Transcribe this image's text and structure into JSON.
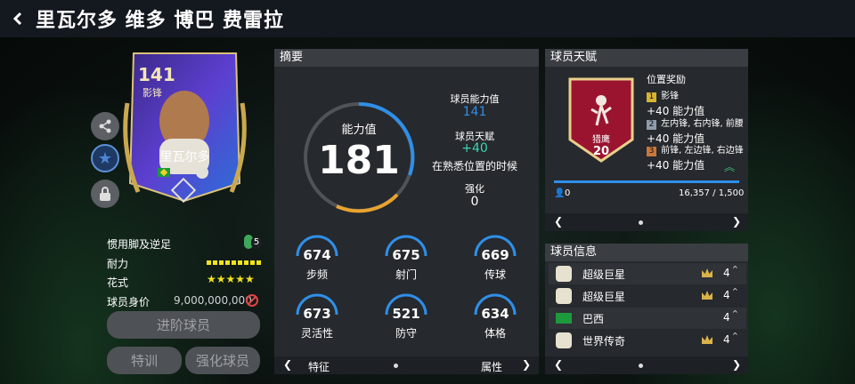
{
  "header": {
    "title": "里瓦尔多 维多 博巴 费雷拉"
  },
  "card": {
    "rating": "141",
    "position": "影锋",
    "name": "里瓦尔多"
  },
  "player": {
    "foot_label": "惯用脚及逆足",
    "foot_value": "5",
    "stamina_label": "耐力",
    "stamina_level": 0.85,
    "skill_label": "花式",
    "skill_stars": "★★★★★",
    "price_label": "球员身价",
    "price_value": "9,000,000,000"
  },
  "buttons": {
    "advance": "进阶球员",
    "train": "特训",
    "upgrade": "强化球员"
  },
  "summary": {
    "header": "摘要",
    "power_label": "能力值",
    "power_value": "181",
    "ability_label": "球员能力值",
    "ability_value": "141",
    "talent_label": "球员天赋",
    "talent_value": "+40",
    "talent_desc": "在熟悉位置的时候",
    "enhance_label": "强化",
    "enhance_value": "0",
    "stats": [
      {
        "value": "674",
        "label": "步频"
      },
      {
        "value": "675",
        "label": "射门"
      },
      {
        "value": "669",
        "label": "传球"
      },
      {
        "value": "673",
        "label": "灵活性"
      },
      {
        "value": "521",
        "label": "防守"
      },
      {
        "value": "634",
        "label": "体格"
      }
    ],
    "nav_left": "特征",
    "nav_right": "属性"
  },
  "talent": {
    "header": "球员天赋",
    "badge_name": "猎鹰",
    "badge_level": "20",
    "bonus_title": "位置奖励",
    "bonuses": [
      {
        "rank": "1",
        "positions": "影锋",
        "bonus": "+40 能力值",
        "color": "#d6b431"
      },
      {
        "rank": "2",
        "positions": "左内锋, 右内锋, 前腰",
        "bonus": "+40 能力值",
        "color": "#8f9aaa"
      },
      {
        "rank": "3",
        "positions": "前锋, 左边锋, 右边锋",
        "bonus": "+40 能力值",
        "color": "#c9773a"
      }
    ],
    "progress_left": "0",
    "progress_right": "16,357 / 1,500",
    "progress_fill": 1.0
  },
  "info": {
    "header": "球员信息",
    "rows": [
      {
        "text": "超级巨星",
        "count": "4"
      },
      {
        "text": "超级巨星",
        "count": "4"
      },
      {
        "text": "巴西",
        "count": "4"
      },
      {
        "text": "世界传奇",
        "count": "4"
      }
    ]
  },
  "colors": {
    "accent": "#2f8fe8",
    "positive": "#39d7b4",
    "panel": "#26292d",
    "gold": "#d9c27a"
  }
}
